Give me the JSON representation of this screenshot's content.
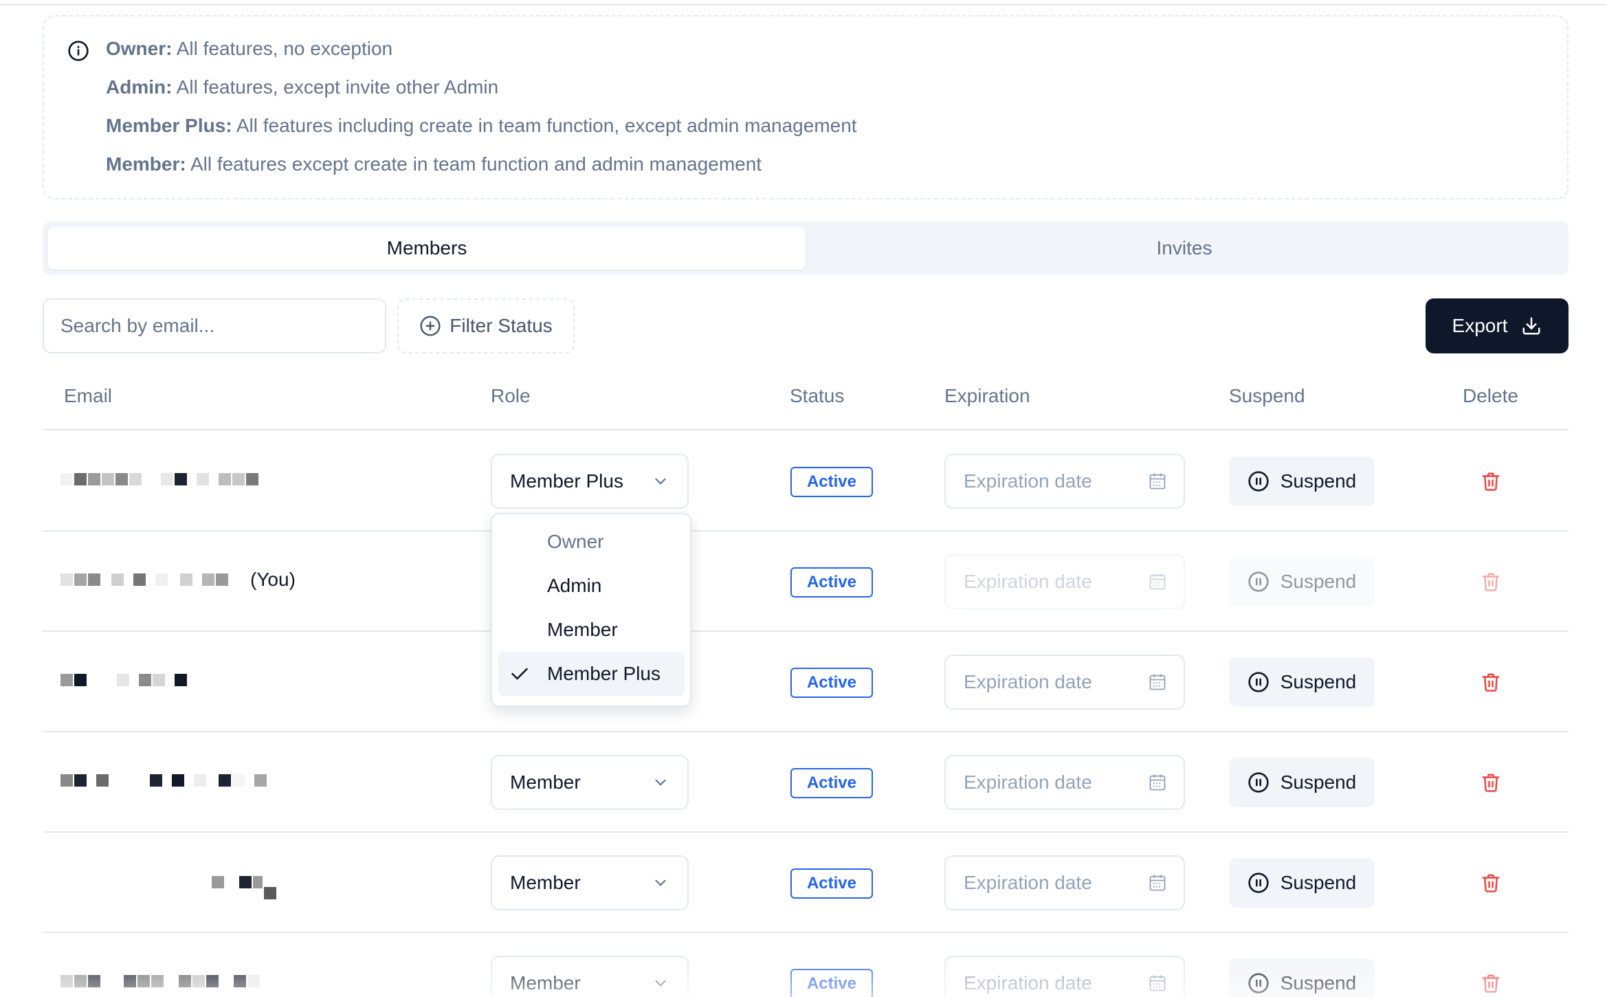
{
  "roles_info": [
    {
      "label": "Owner:",
      "text": " All features, no exception"
    },
    {
      "label": "Admin:",
      "text": " All features, except invite other Admin"
    },
    {
      "label": "Member Plus:",
      "text": " All features including create in team function, except admin management"
    },
    {
      "label": "Member:",
      "text": " All features except create in team function and admin management"
    }
  ],
  "tabs": [
    {
      "label": "Members",
      "active": true
    },
    {
      "label": "Invites",
      "active": false
    }
  ],
  "toolbar": {
    "search_placeholder": "Search by email...",
    "filter_label": "Filter Status",
    "export_label": "Export"
  },
  "table": {
    "headers": [
      "Email",
      "Role",
      "Status",
      "Expiration",
      "Suspend",
      "Delete"
    ],
    "rows": [
      {
        "role": "Member Plus",
        "status": "Active",
        "expiration_placeholder": "Expiration date",
        "suspend_label": "Suspend",
        "you_label": "",
        "disabled": false
      },
      {
        "role": "",
        "status": "Active",
        "expiration_placeholder": "Expiration date",
        "suspend_label": "Suspend",
        "you_label": "(You)",
        "disabled": true
      },
      {
        "role": "",
        "status": "Active",
        "expiration_placeholder": "Expiration date",
        "suspend_label": "Suspend",
        "you_label": "",
        "disabled": false
      },
      {
        "role": "Member",
        "status": "Active",
        "expiration_placeholder": "Expiration date",
        "suspend_label": "Suspend",
        "you_label": "",
        "disabled": false
      },
      {
        "role": "Member",
        "status": "Active",
        "expiration_placeholder": "Expiration date",
        "suspend_label": "Suspend",
        "you_label": "",
        "disabled": false
      },
      {
        "role": "Member",
        "status": "Active",
        "expiration_placeholder": "Expiration date",
        "suspend_label": "Suspend",
        "you_label": "",
        "disabled": false
      }
    ]
  },
  "role_dropdown": {
    "options": [
      "Owner",
      "Admin",
      "Member",
      "Member Plus"
    ],
    "selected": "Member Plus",
    "disabled_option": "Owner"
  },
  "colors": {
    "primary": "#0f172a",
    "status_active": "#2563eb",
    "delete_red": "#ef4444",
    "muted_text": "#64748b"
  },
  "icons": [
    "info-icon",
    "plus-circle-icon",
    "download-icon",
    "chevron-down-icon",
    "calendar-icon",
    "pause-circle-icon",
    "trash-icon",
    "check-icon"
  ]
}
